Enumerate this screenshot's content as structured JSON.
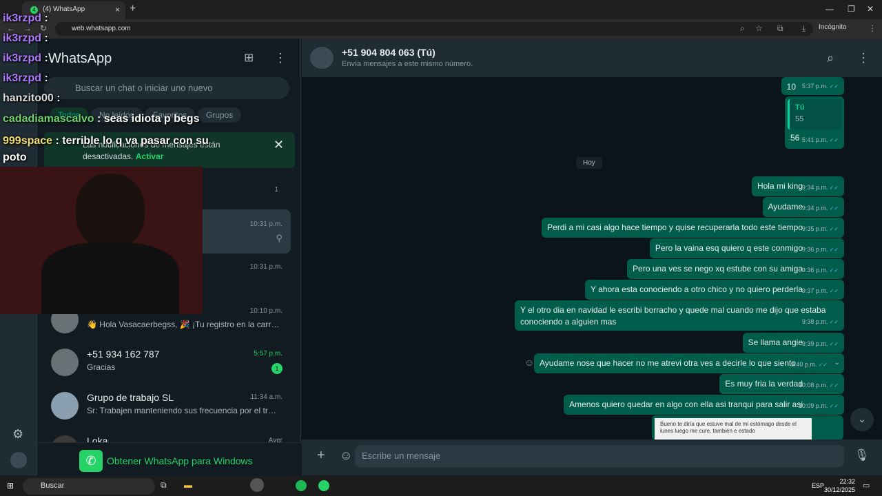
{
  "browser": {
    "tab_title": "(4) WhatsApp",
    "tab_badge": "4",
    "url": "web.whatsapp.com",
    "incognito": "Incógnito"
  },
  "sidebar": {
    "app_name": "WhatsApp",
    "search_placeholder": "Buscar un chat o iniciar uno nuevo",
    "filters": [
      "Todos",
      "No leídos",
      "Favoritos",
      "Grupos"
    ],
    "notification": {
      "text": "Las notificaciones de mensajes están desactivadas.",
      "action": "Activar"
    },
    "chats": [
      {
        "time": "",
        "preview": "",
        "badge": "1"
      },
      {
        "time": "10:31 p.m.",
        "preview": ""
      },
      {
        "time": "10:31 p.m.",
        "preview": ""
      },
      {
        "time": "10:10 p.m.",
        "preview": "👋 Hola Vasacaerbegss, 🎉 ¡Tu registro en la carrer..."
      },
      {
        "name": "+51 934 162 787",
        "time": "5:57 p.m.",
        "preview": "Gracias",
        "badge": "1"
      },
      {
        "name": "Grupo de trabajo SL",
        "time": "11:34 a.m.",
        "preview": "Sr: Trabajen manteniendo sus frecuencia por el trafi..."
      },
      {
        "name": "Loka",
        "time": "Ayer",
        "preview": ""
      }
    ],
    "get_windows": "Obtener WhatsApp para Windows"
  },
  "chat": {
    "contact_name": "+51 904 804 063 (Tú)",
    "contact_subtitle": "Envía mensajes a este mismo número.",
    "day_label": "Hoy",
    "messages": [
      {
        "text": "10",
        "time": "5:37 p.m."
      },
      {
        "quote_author": "Tú",
        "quote_text": "55",
        "text": "56",
        "time": "5:41 p.m."
      },
      {
        "text": "Hola mi king",
        "time": "9:34 p.m."
      },
      {
        "text": "Ayudame",
        "time": "9:34 p.m."
      },
      {
        "text": "Perdi a mi casi algo hace tiempo y quise recuperarla todo este tiempo",
        "time": "9:35 p.m."
      },
      {
        "text": "Pero la vaina esq quiero q este conmigo",
        "time": "9:36 p.m."
      },
      {
        "text": "Pero una ves se nego xq estube con su amiga",
        "time": "9:36 p.m."
      },
      {
        "text": "Y ahora esta conociendo a otro chico y no quiero perderla",
        "time": "9:37 p.m."
      },
      {
        "text": "Y el otro dia en navidad le escribi borracho y quede mal cuando me dijo que estaba conociendo a alguien mas",
        "time": "9:38 p.m."
      },
      {
        "text": "Se llama angie",
        "time": "9:39 p.m."
      },
      {
        "text": "Ayudame nose que hacer no me atrevi otra ves a decirle lo que siento",
        "time": "9:40 p.m."
      },
      {
        "text": "Es muy fria la verdad",
        "time": "10:08 p.m."
      },
      {
        "text": "Amenos quiero quedar en algo con ella asi tranqui para salir asi",
        "time": "10:09 p.m."
      },
      {
        "image_caption": "Bueno te diría que estuve mal de mi estómago desde el lunes luego me cure, también e estado"
      }
    ],
    "composer_placeholder": "Escribe un mensaje"
  },
  "stream_chat": [
    {
      "user": "ik3rzpd",
      "text": ":"
    },
    {
      "user": "ik3rzpd",
      "text": ":"
    },
    {
      "user": "ik3rzpd",
      "text": ":"
    },
    {
      "user": "ik3rzpd",
      "text": ":"
    },
    {
      "user": "hanzito00",
      "text": ":"
    },
    {
      "user": "cadadiamascalvo",
      "text": ": seas idiota p begs"
    },
    {
      "user": "999space",
      "text": ": terrible lo q va pasar con su poto"
    }
  ],
  "taskbar": {
    "search": "Buscar",
    "lang": "ESP",
    "time": "22:32",
    "date": "30/12/2025"
  },
  "colors": {
    "accent": "#25d366",
    "bubble_out": "#005c4b",
    "panel": "#111b21",
    "header": "#202c33"
  }
}
